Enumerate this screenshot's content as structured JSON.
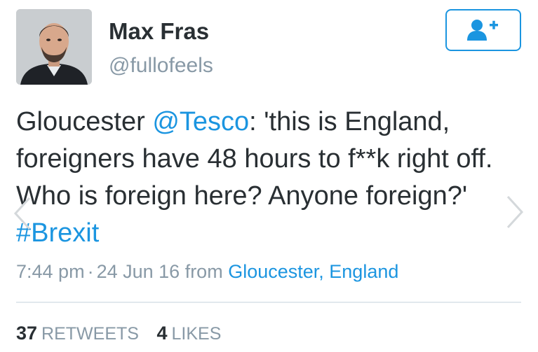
{
  "profile": {
    "display_name": "Max Fras",
    "handle": "@fullofeels"
  },
  "follow_button": {
    "icon": "add-user-icon",
    "color": "#1b95e0"
  },
  "tweet": {
    "segments": {
      "s1": "Gloucester ",
      "mention": "@Tesco",
      "s2": ": 'this is England, foreigners have 48 hours to f**k right off. Who is foreign here? Anyone foreign?' ",
      "hashtag": "#Brexit"
    },
    "time": "7:44 pm",
    "separator": "·",
    "date": "24 Jun 16",
    "from_label": "from",
    "location": "Gloucester, England"
  },
  "stats": {
    "retweets_count": "37",
    "retweets_label": "RETWEETS",
    "likes_count": "4",
    "likes_label": "LIKES"
  },
  "colors": {
    "link": "#1b95e0",
    "text": "#292f33",
    "muted": "#8899a6",
    "divider": "#e1e8ed"
  },
  "icons": [
    "person-avatar",
    "add-user-icon",
    "chevron-left-icon",
    "chevron-right-icon"
  ]
}
